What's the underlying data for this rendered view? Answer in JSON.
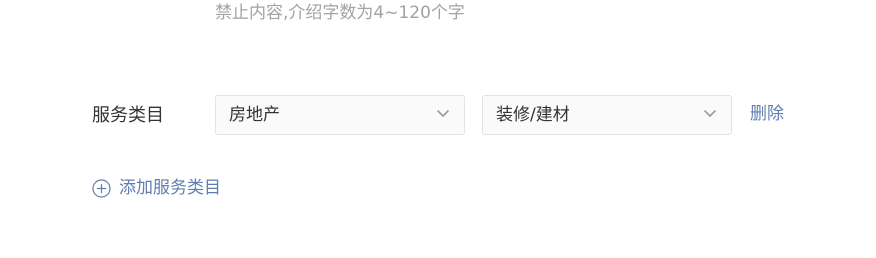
{
  "hint_text": "禁止内容,介绍字数为4~120个字",
  "service_row": {
    "label": "服务类目",
    "primary_select": {
      "value": "房地产",
      "icon": "chevron-down-icon"
    },
    "secondary_select": {
      "value": "装修/建材",
      "icon": "chevron-down-icon"
    },
    "delete_label": "删除"
  },
  "add_button": {
    "label": "添加服务类目",
    "icon": "plus-circle-icon"
  },
  "colors": {
    "link": "#5f7db0",
    "hint": "#a3a3a3",
    "text": "#333333",
    "border": "#e3e3e3",
    "select_bg": "#fafafa"
  }
}
